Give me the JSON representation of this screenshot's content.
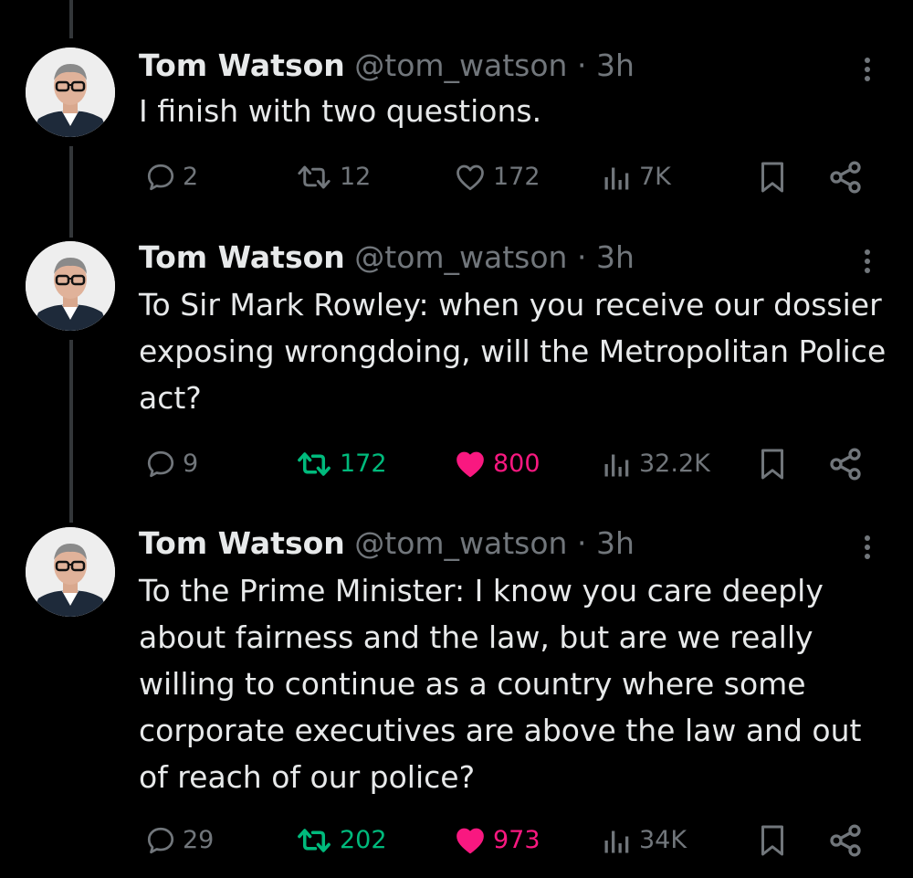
{
  "colors": {
    "background": "#000000",
    "text": "#e7e9ea",
    "muted": "#71767b",
    "retweet_active": "#00ba7c",
    "like_active": "#f91880",
    "thread_line": "#333639"
  },
  "tweets": [
    {
      "author_name": "Tom Watson",
      "handle": "@tom_watson",
      "separator": "·",
      "time": "3h",
      "text": "I finish with two questions.",
      "replies": "2",
      "retweets": "12",
      "likes": "172",
      "views": "7K",
      "retweeted": false,
      "liked": false
    },
    {
      "author_name": "Tom Watson",
      "handle": "@tom_watson",
      "separator": "·",
      "time": "3h",
      "text": "To Sir Mark Rowley: when you receive our dossier exposing wrongdoing, will the Metropolitan Police act?",
      "replies": "9",
      "retweets": "172",
      "likes": "800",
      "views": "32.2K",
      "retweeted": true,
      "liked": true
    },
    {
      "author_name": "Tom Watson",
      "handle": "@tom_watson",
      "separator": "·",
      "time": "3h",
      "text": "To the Prime Minister: I know you care deeply about fairness and the law, but are we really willing to continue as a country where some corporate executives are above the law and out of reach of our police?",
      "replies": "29",
      "retweets": "202",
      "likes": "973",
      "views": "34K",
      "retweeted": true,
      "liked": true
    }
  ]
}
